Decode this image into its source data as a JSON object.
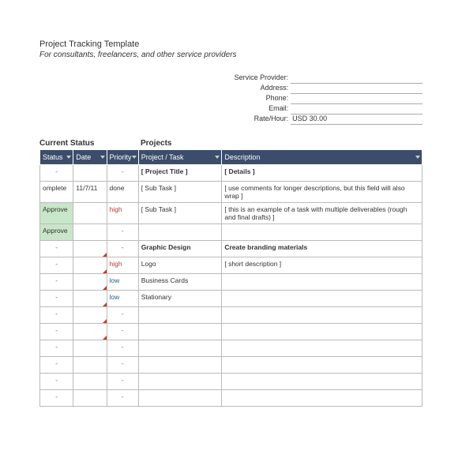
{
  "header": {
    "title": "Project Tracking Template",
    "subtitle": "For consultants, freelancers, and other service providers"
  },
  "info": {
    "provider_label": "Service Provider:",
    "address_label": "Address:",
    "phone_label": "Phone:",
    "email_label": "Email:",
    "rate_label": "Rate/Hour:",
    "provider_value": "",
    "address_value": "",
    "phone_value": "",
    "email_value": "",
    "rate_value": "USD 30.00"
  },
  "sections": {
    "status": "Current Status",
    "projects": "Projects"
  },
  "columns": {
    "status": "Status",
    "date": "Date",
    "priority": "Priority",
    "project": "Project / Task",
    "description": "Description"
  },
  "rows": [
    {
      "status": "-",
      "date": "",
      "priority": "-",
      "project": "[ Project Title ]",
      "description": "[ Details ]",
      "bold": true
    },
    {
      "status": "omplete",
      "date": "11/7/11",
      "priority": "done",
      "project": "[ Sub Task ]",
      "description": "[ use comments for longer descriptions, but this field will also wrap ]"
    },
    {
      "status": "Approve",
      "date": "",
      "priority": "high",
      "project": "[ Sub Task ]",
      "description": "[ this is an example of a task with multiple deliverables (rough and final drafts) ]",
      "statusGreen": true,
      "priColor": "high"
    },
    {
      "status": "Approve",
      "date": "",
      "priority": "-",
      "project": "",
      "description": "",
      "statusGreen": true
    },
    {
      "status": "-",
      "date": "",
      "priority": "-",
      "project": "Graphic Design",
      "description": "Create branding materials",
      "bold": true,
      "redCorner": true
    },
    {
      "status": "-",
      "date": "",
      "priority": "high",
      "project": "Logo",
      "description": "[ short description ]",
      "redCorner": true,
      "priColor": "high"
    },
    {
      "status": "-",
      "date": "",
      "priority": "low",
      "project": "Business Cards",
      "description": "",
      "redCorner": true,
      "priColor": "low"
    },
    {
      "status": "-",
      "date": "",
      "priority": "low",
      "project": "Stationary",
      "description": "",
      "redCorner": true,
      "priColor": "low"
    },
    {
      "status": "-",
      "date": "",
      "priority": "-",
      "project": "",
      "description": "",
      "redCorner": true
    },
    {
      "status": "-",
      "date": "",
      "priority": "-",
      "project": "",
      "description": "",
      "redCorner": true
    },
    {
      "status": "-",
      "date": "",
      "priority": "-",
      "project": "",
      "description": ""
    },
    {
      "status": "-",
      "date": "",
      "priority": "-",
      "project": "",
      "description": ""
    },
    {
      "status": "-",
      "date": "",
      "priority": "-",
      "project": "",
      "description": ""
    },
    {
      "status": "-",
      "date": "",
      "priority": "-",
      "project": "",
      "description": ""
    }
  ]
}
